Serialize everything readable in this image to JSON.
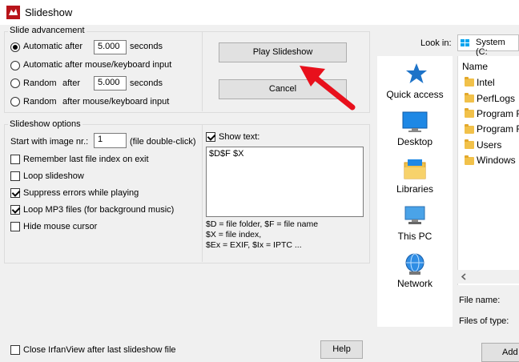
{
  "window": {
    "title": "Slideshow"
  },
  "advancement": {
    "legend": "Slide advancement",
    "auto_after_label": "Automatic after",
    "auto_after_value": "5.000",
    "auto_after_unit": "seconds",
    "auto_input_label": "Automatic after mouse/keyboard input",
    "random_label": "Random",
    "random_after_label": "after",
    "random_value": "5.000",
    "random_unit": "seconds",
    "random_input_label": "Random",
    "random_input_suffix": "after mouse/keyboard input"
  },
  "buttons": {
    "play": "Play Slideshow",
    "cancel": "Cancel",
    "help": "Help",
    "add": "Add"
  },
  "options": {
    "legend": "Slideshow options",
    "start_label": "Start with image nr.:",
    "start_value": "1",
    "start_hint": "(file double-click)",
    "remember": "Remember last file index on exit",
    "loop": "Loop slideshow",
    "suppress": "Suppress errors while playing",
    "loop_mp3": "Loop MP3 files (for background music)",
    "hide_cursor": "Hide mouse cursor"
  },
  "show_text": {
    "label": "Show text:",
    "value": "$D$F $X",
    "help1": "$D = file folder, $F = file name",
    "help2": "$X = file index,",
    "help3": "$Ex = EXIF, $Ix = IPTC ..."
  },
  "bottom": {
    "close_label": "Close IrfanView after last slideshow file"
  },
  "file_dialog": {
    "look_in_label": "Look in:",
    "look_in_value": "System (C:",
    "places": [
      "Quick access",
      "Desktop",
      "Libraries",
      "This PC",
      "Network"
    ],
    "column_name": "Name",
    "folders": [
      "Intel",
      "PerfLogs",
      "Program F",
      "Program F",
      "Users",
      "Windows"
    ],
    "file_name_label": "File name:",
    "files_of_type_label": "Files of type:"
  },
  "colors": {
    "accent": "#1e73c8",
    "arrow": "#e8101c",
    "folder": "#f1c14a"
  }
}
